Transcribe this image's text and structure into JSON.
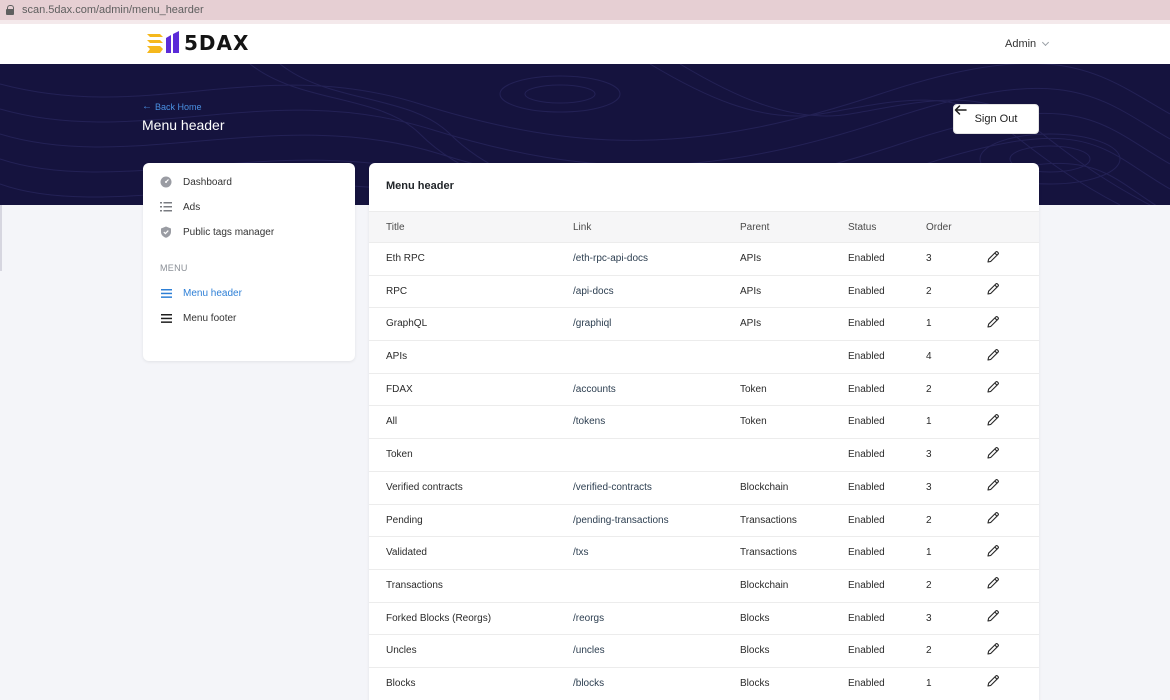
{
  "browser": {
    "url": "scan.5dax.com/admin/menu_hearder"
  },
  "header": {
    "logo_text": "5DAX",
    "admin_label": "Admin"
  },
  "banner": {
    "back_label": "Back Home",
    "title": "Menu header",
    "signout_label": "Sign Out"
  },
  "sidebar": {
    "items": [
      {
        "label": "Dashboard",
        "icon": "dashboard-icon"
      },
      {
        "label": "Ads",
        "icon": "list-icon"
      },
      {
        "label": "Public tags manager",
        "icon": "shield-icon"
      }
    ],
    "section_label": "MENU",
    "menu_items": [
      {
        "label": "Menu header",
        "icon": "menu-icon",
        "active": true
      },
      {
        "label": "Menu footer",
        "icon": "menu-icon",
        "active": false
      }
    ]
  },
  "table": {
    "title": "Menu header",
    "columns": [
      "Title",
      "Link",
      "Parent",
      "Status",
      "Order"
    ],
    "rows": [
      {
        "title": "Eth RPC",
        "link": "/eth-rpc-api-docs",
        "parent": "APIs",
        "status": "Enabled",
        "order": "3"
      },
      {
        "title": "RPC",
        "link": "/api-docs",
        "parent": "APIs",
        "status": "Enabled",
        "order": "2"
      },
      {
        "title": "GraphQL",
        "link": "/graphiql",
        "parent": "APIs",
        "status": "Enabled",
        "order": "1"
      },
      {
        "title": "APIs",
        "link": "",
        "parent": "",
        "status": "Enabled",
        "order": "4"
      },
      {
        "title": "FDAX",
        "link": "/accounts",
        "parent": "Token",
        "status": "Enabled",
        "order": "2"
      },
      {
        "title": "All",
        "link": "/tokens",
        "parent": "Token",
        "status": "Enabled",
        "order": "1"
      },
      {
        "title": "Token",
        "link": "",
        "parent": "",
        "status": "Enabled",
        "order": "3"
      },
      {
        "title": "Verified contracts",
        "link": "/verified-contracts",
        "parent": "Blockchain",
        "status": "Enabled",
        "order": "3"
      },
      {
        "title": "Pending",
        "link": "/pending-transactions",
        "parent": "Transactions",
        "status": "Enabled",
        "order": "2"
      },
      {
        "title": "Validated",
        "link": "/txs",
        "parent": "Transactions",
        "status": "Enabled",
        "order": "1"
      },
      {
        "title": "Transactions",
        "link": "",
        "parent": "Blockchain",
        "status": "Enabled",
        "order": "2"
      },
      {
        "title": "Forked Blocks (Reorgs)",
        "link": "/reorgs",
        "parent": "Blocks",
        "status": "Enabled",
        "order": "3"
      },
      {
        "title": "Uncles",
        "link": "/uncles",
        "parent": "Blocks",
        "status": "Enabled",
        "order": "2"
      },
      {
        "title": "Blocks",
        "link": "/blocks",
        "parent": "Blocks",
        "status": "Enabled",
        "order": "1"
      }
    ]
  },
  "colors": {
    "banner_bg": "#15133e",
    "accent": "#2d7fd6",
    "logo_yellow": "#f5b81c",
    "logo_purple": "#5b2bd8"
  }
}
